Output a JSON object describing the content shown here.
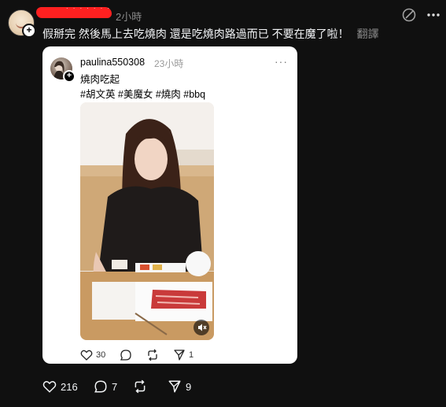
{
  "post": {
    "time": "2小時",
    "caption": "假掰完 然後馬上去吃燒肉 還是吃燒肉路過而已 不要在魔了啦！",
    "translate_label": "翻譯",
    "redacted_mark": "˙ ˙ ˙ ˙ ˙ ˙ ˙",
    "likes": "216",
    "replies": "7",
    "shares": "9"
  },
  "quoted": {
    "username": "paulina550308",
    "time": "23小時",
    "line1": "燒肉吃起",
    "line2": "#胡文英 #美魔女 #燒肉 #bbq",
    "likes": "30",
    "shares": "1"
  },
  "icons": {
    "top_left": "edit-icon",
    "top_right": "more-icon",
    "like": "heart-icon",
    "reply": "comment-icon",
    "repost": "repost-icon",
    "share": "send-icon",
    "mute": "muted-speaker-icon"
  }
}
